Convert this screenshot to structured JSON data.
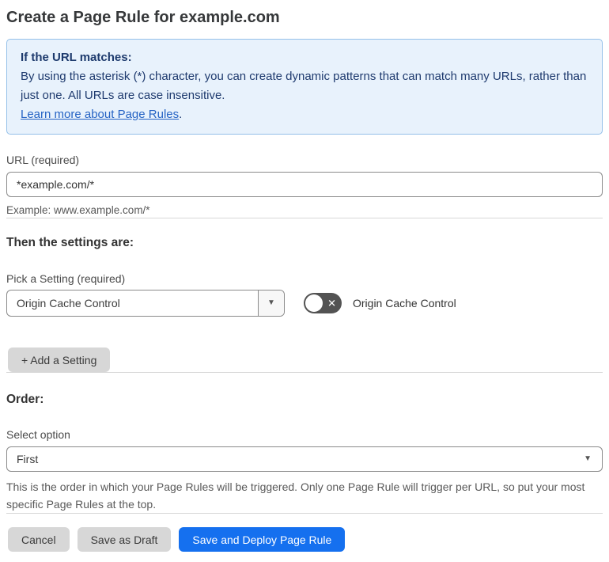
{
  "page": {
    "title": "Create a Page Rule for example.com"
  },
  "info_box": {
    "heading": "If the URL matches:",
    "body": "By using the asterisk (*) character, you can create dynamic patterns that can match many URLs, rather than just one. All URLs are case insensitive.",
    "link_label": "Learn more about Page Rules",
    "link_suffix": "."
  },
  "url_field": {
    "label": "URL (required)",
    "value": "*example.com/*",
    "example": "Example: www.example.com/*"
  },
  "settings_section": {
    "heading": "Then the settings are:",
    "pick_label": "Pick a Setting (required)",
    "selected_setting": "Origin Cache Control",
    "toggle_state": "off",
    "toggle_label": "Origin Cache Control",
    "add_button_label": "+ Add a Setting"
  },
  "order_section": {
    "heading": "Order:",
    "label": "Select option",
    "selected_option": "First",
    "help_text": "This is the order in which your Page Rules will be triggered. Only one Page Rule will trigger per URL, so put your most specific Page Rules at the top."
  },
  "footer": {
    "cancel_label": "Cancel",
    "save_draft_label": "Save as Draft",
    "save_deploy_label": "Save and Deploy Page Rule"
  },
  "icons": {
    "caret_down": "▼",
    "toggle_off_x": "✕"
  },
  "colors": {
    "accent_blue": "#1570ef",
    "info_bg": "#e8f2fc",
    "info_border": "#94c0e9",
    "info_text": "#1e3a6e",
    "link_blue": "#2563c4",
    "toggle_off_bg": "#535353",
    "gray_button_bg": "#d7d7d7"
  }
}
